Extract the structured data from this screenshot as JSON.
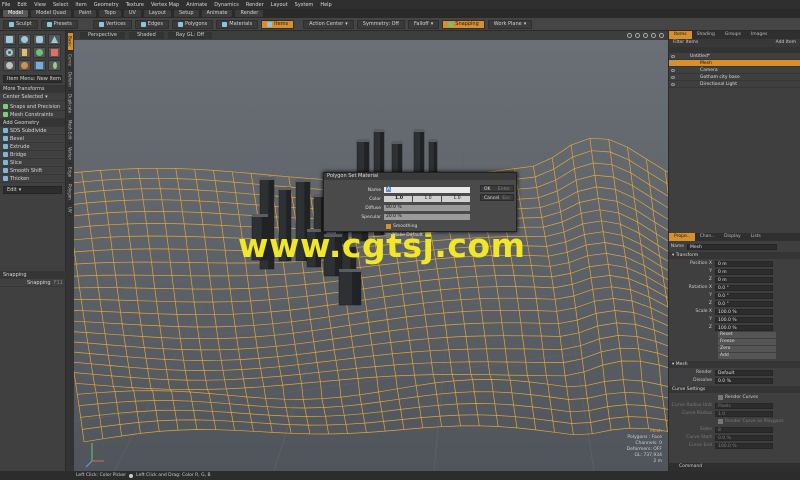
{
  "menubar": [
    "File",
    "Edit",
    "View",
    "Select",
    "Item",
    "Geometry",
    "Texture",
    "Vertex Map",
    "Animate",
    "Dynamics",
    "Render",
    "Layout",
    "System",
    "Help"
  ],
  "tabs": [
    {
      "label": "Model",
      "active": true
    },
    {
      "label": "Model Quad",
      "active": false
    },
    {
      "label": "Paint",
      "active": false
    },
    {
      "label": "Topo",
      "active": false
    },
    {
      "label": "UV",
      "active": false
    },
    {
      "label": "Layout",
      "active": false
    },
    {
      "label": "Setup",
      "active": false
    },
    {
      "label": "Animate",
      "active": false
    },
    {
      "label": "Render",
      "active": false
    }
  ],
  "toolbar": {
    "sculpt": "Sculpt",
    "presets": "Presets",
    "vertices": "Vertices",
    "edges": "Edges",
    "polygons": "Polygons",
    "materials": "Materials",
    "items": "Items",
    "action_center": "Action Center",
    "symmetry": "Symmetry: Off",
    "falloff": "Falloff",
    "snapping": "Snapping",
    "work_plane": "Work Plane"
  },
  "left": {
    "item_menu": "Item Menu: New Item",
    "more_transforms": "More Transforms",
    "center_selected": "Center Selected",
    "snaps": "Snaps and Precision",
    "mesh_constraints": "Mesh Constraints",
    "add_geometry": "Add Geometry",
    "tools": [
      "SDS Subdivide",
      "Bevel",
      "Extrude",
      "Bridge",
      "Slice",
      "Smooth Shift",
      "Thicken"
    ],
    "edit": "Edit",
    "snapping_panel": "Snapping",
    "snapping_row": "Snapping",
    "snapping_val": "F11"
  },
  "lefttabs": [
    "Basic",
    "Curve",
    "Deform",
    "Duplicate",
    "Mesh Edit",
    "Vertex",
    "Edge",
    "Polygon",
    "UV"
  ],
  "viewport": {
    "perspective": "Perspective",
    "shaded": "Shaded",
    "ray_gl": "Ray GL: Off",
    "info": {
      "mesh": "Mesh",
      "polygons": "Polygons : Face",
      "channels": "Channels: 0",
      "deformers": "Deformers: OFF",
      "gl": "GL: 737,934",
      "scale": "2 m"
    }
  },
  "dialog": {
    "title": "Polygon Set Material",
    "name_label": "Name",
    "name_val": "A",
    "color_label": "Color",
    "color_vals": [
      "1.0",
      "1.0",
      "1.0"
    ],
    "diffuse_label": "Diffuse",
    "diffuse_val": "80.0 %",
    "specular_label": "Specular",
    "specular_val": "20.0 %",
    "smoothing": "Smoothing",
    "make_default": "Make Default",
    "ok": "OK",
    "ok_key": "Enter",
    "cancel": "Cancel",
    "cancel_key": "Esc"
  },
  "watermark": "www.cgtsj.com",
  "items_panel": {
    "tabs": [
      "Items",
      "Shading",
      "Groups",
      "Images"
    ],
    "filter": "Filter Items",
    "add": "Add Item",
    "rows": [
      {
        "label": "Untitled*",
        "indent": 0,
        "selected": false
      },
      {
        "label": "Mesh",
        "indent": 1,
        "selected": true
      },
      {
        "label": "Camera",
        "indent": 1,
        "selected": false
      },
      {
        "label": "Gotham city base",
        "indent": 1,
        "selected": false
      },
      {
        "label": "Directional Light",
        "indent": 1,
        "selected": false
      }
    ]
  },
  "props": {
    "tabs": [
      "Prope..",
      "Chan..",
      "Display",
      "Lists"
    ],
    "name_label": "Name",
    "name_val": "Mesh",
    "transform": "Transform",
    "position": [
      {
        "l": "Position X",
        "v": "0 m"
      },
      {
        "l": "Y",
        "v": "0 m"
      },
      {
        "l": "Z",
        "v": "0 m"
      }
    ],
    "rotation": [
      {
        "l": "Rotation X",
        "v": "0.0 °"
      },
      {
        "l": "Y",
        "v": "0.0 °"
      },
      {
        "l": "Z",
        "v": "0.0 °"
      }
    ],
    "scale": [
      {
        "l": "Scale X",
        "v": "100.0 %"
      },
      {
        "l": "Y",
        "v": "100.0 %"
      },
      {
        "l": "Z",
        "v": "100.0 %"
      }
    ],
    "buttons": [
      "Reset",
      "Freeze",
      "Zero",
      "Add"
    ],
    "mesh": "Mesh",
    "render_label": "Render",
    "render_val": "Default",
    "dissolve_label": "Dissolve",
    "dissolve_val": "0.0 %",
    "curve_settings": "Curve Settings",
    "render_curves": "Render Curves",
    "curve_radius_unit": "Curve Radius Unit",
    "curve_radius_unit_val": "Pixels",
    "curve_radius": "Curve Radius",
    "curve_radius_val": "1.0",
    "render_as_polygons": "Render Curve as Polygons",
    "sides": "Sides",
    "sides_val": "8",
    "curve_start": "Curve Start",
    "curve_start_val": "0.0 %",
    "curve_end": "Curve End",
    "curve_end_val": "100.0 %",
    "command": "Command"
  },
  "status": {
    "left": "Left Click: Color Picker",
    "right": "Left Click and Drag: Color R, G, B"
  }
}
